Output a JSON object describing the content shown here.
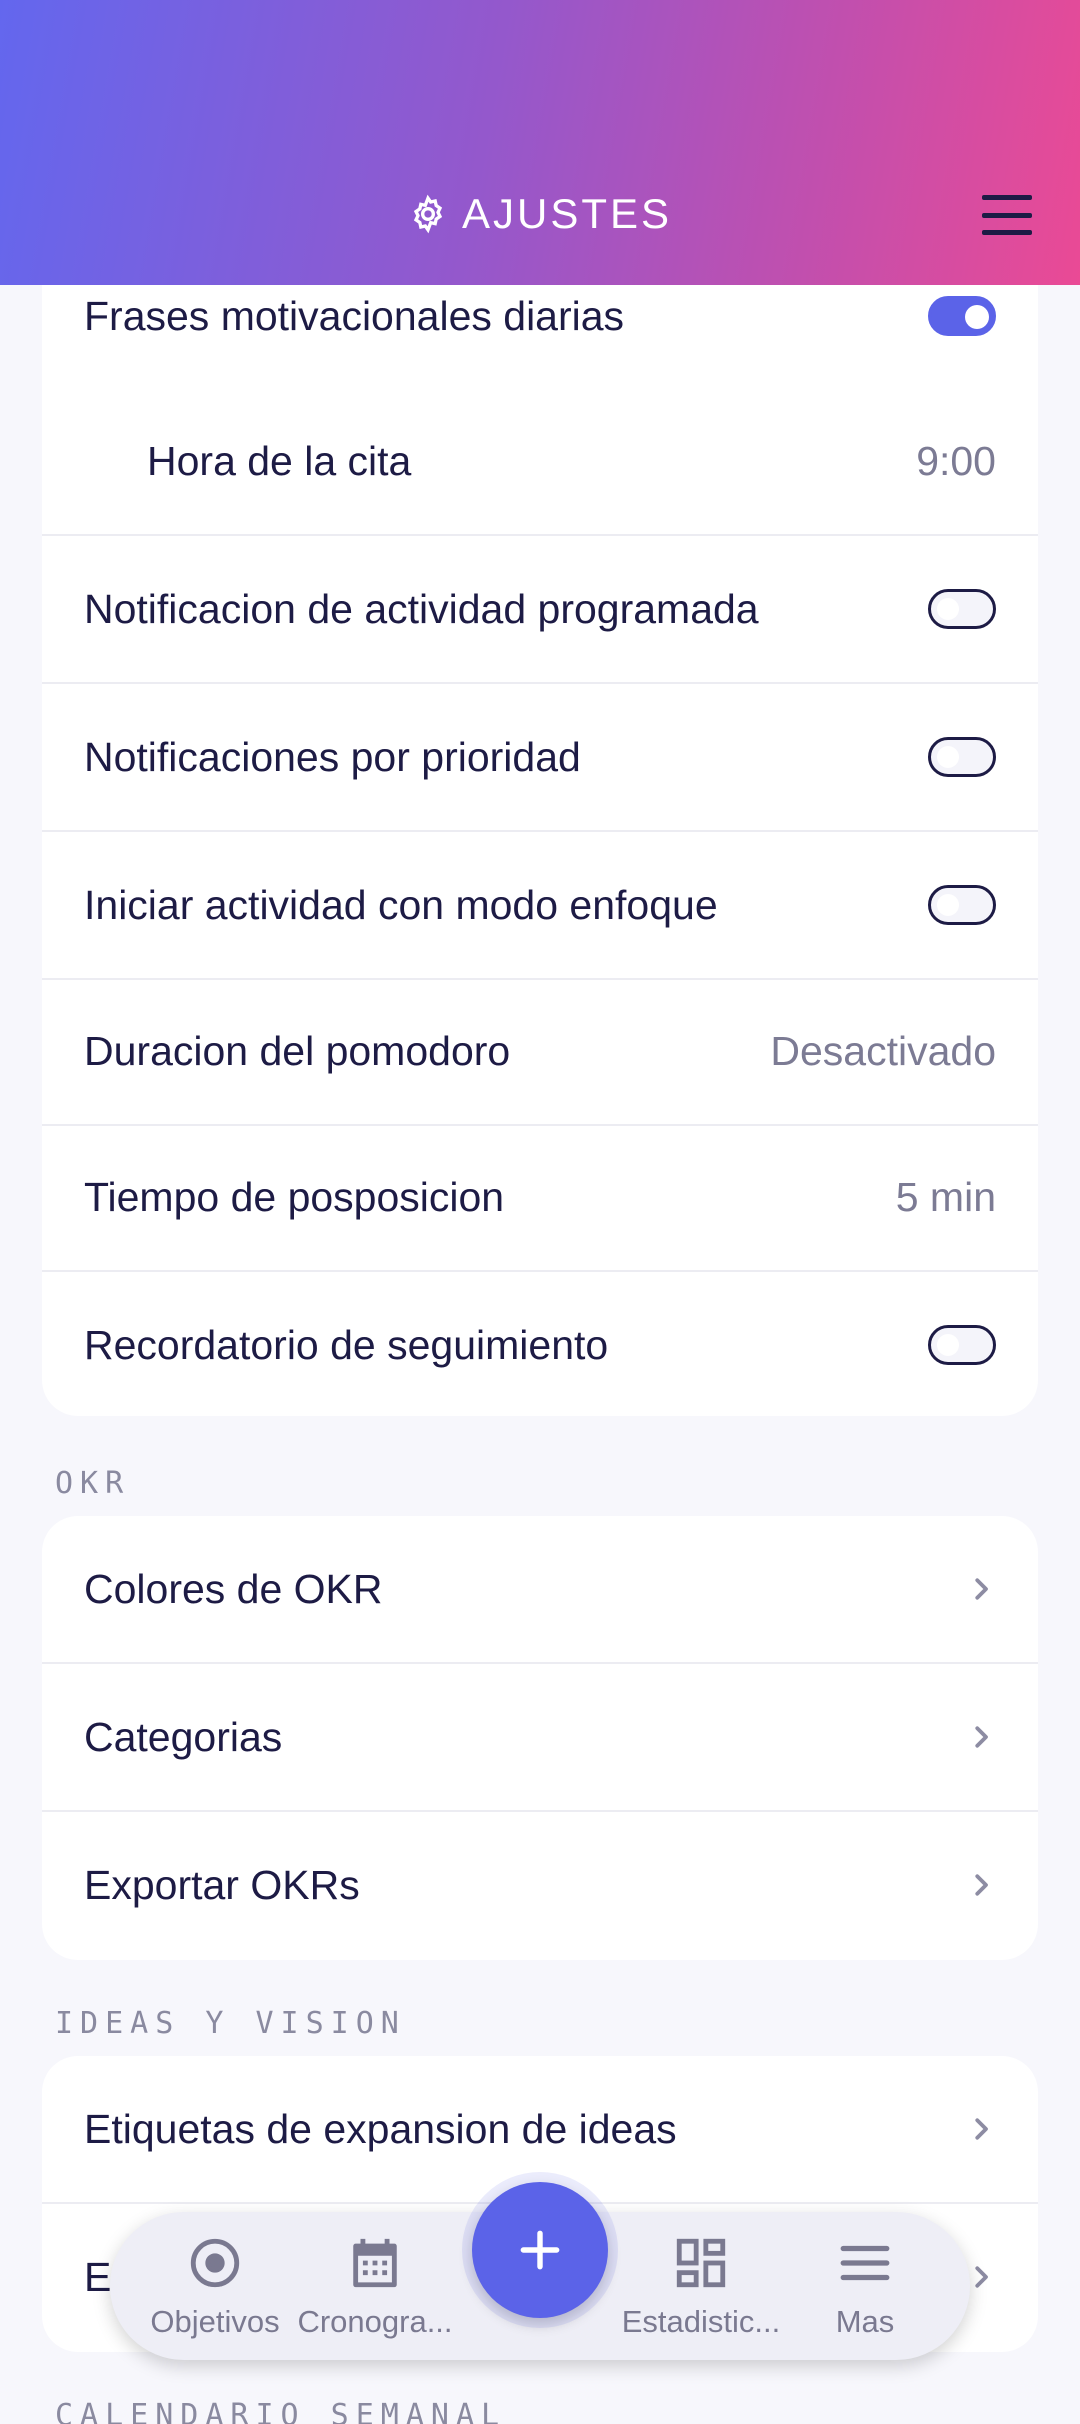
{
  "header": {
    "title": "AJUSTES",
    "icon": "gear-icon",
    "menu_icon": "hamburger-menu-icon"
  },
  "notifications": [
    {
      "label": "Frases motivacionales diarias",
      "type": "toggle",
      "on": true
    },
    {
      "label": "Hora de la cita",
      "type": "value",
      "value": "9:00"
    },
    {
      "label": "Notificacion de actividad programada",
      "type": "toggle",
      "on": false
    },
    {
      "label": "Notificaciones por prioridad",
      "type": "toggle",
      "on": false
    },
    {
      "label": "Iniciar actividad con modo enfoque",
      "type": "toggle",
      "on": false
    },
    {
      "label": "Duracion del pomodoro",
      "type": "value",
      "value": "Desactivado"
    },
    {
      "label": "Tiempo de posposicion",
      "type": "value",
      "value": "5 min"
    },
    {
      "label": "Recordatorio de seguimiento",
      "type": "toggle",
      "on": false
    }
  ],
  "okr": {
    "label": "OKR",
    "items": [
      "Colores de OKR",
      "Categorias",
      "Exportar OKRs"
    ]
  },
  "ideas": {
    "label": "IDEAS Y VISION",
    "items": [
      "Etiquetas de expansion de ideas",
      "E"
    ]
  },
  "next_section_label": "CALENDARIO SEMANAL",
  "bottom_nav": [
    {
      "label": "Objetivos",
      "icon": "target-icon"
    },
    {
      "label": "Cronogra...",
      "icon": "calendar-icon"
    },
    {
      "label": "Estadistic...",
      "icon": "dashboard-icon"
    },
    {
      "label": "Mas",
      "icon": "menu-icon"
    }
  ],
  "fab": {
    "icon": "plus-icon"
  },
  "colors": {
    "accent": "#5b63e8",
    "text": "#1d1b45",
    "muted": "#7c7b94",
    "gradient_start": "#6367ee",
    "gradient_end": "#ea4a95"
  }
}
